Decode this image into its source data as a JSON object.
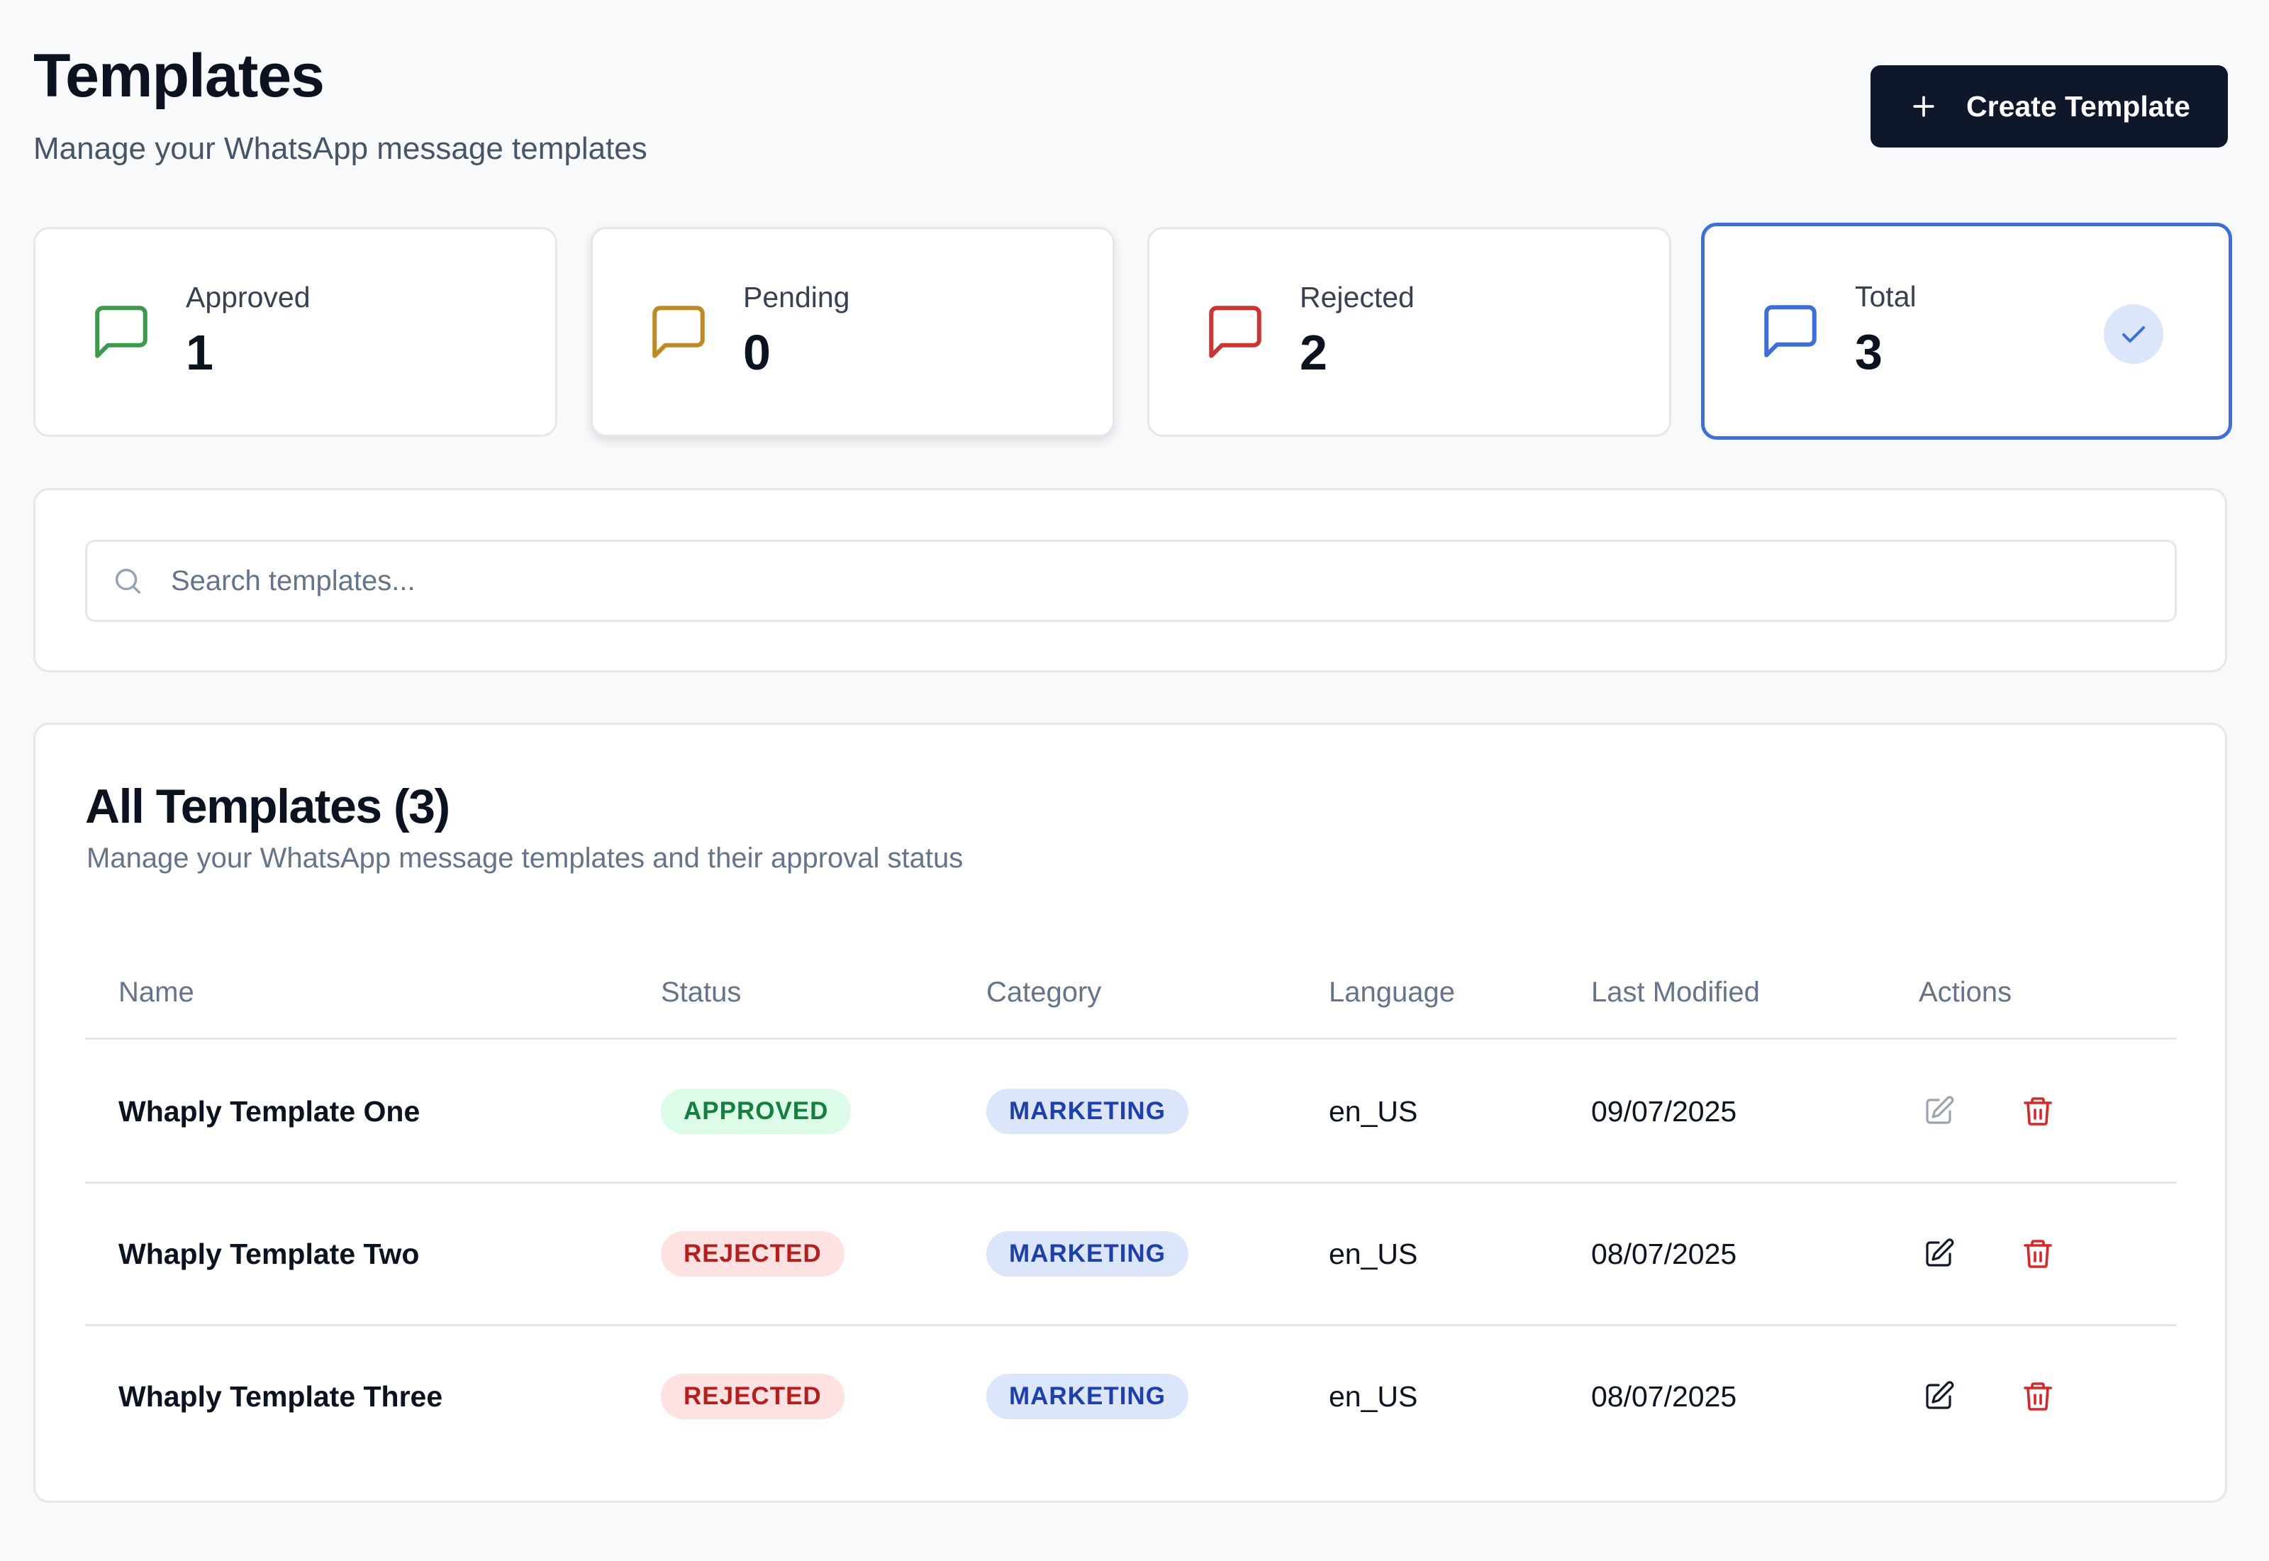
{
  "header": {
    "title": "Templates",
    "subtitle": "Manage your WhatsApp message templates",
    "create_button_label": "Create Template"
  },
  "stats": [
    {
      "label": "Approved",
      "value": "1",
      "color": "#3b9a4c"
    },
    {
      "label": "Pending",
      "value": "0",
      "color": "#c08a23"
    },
    {
      "label": "Rejected",
      "value": "2",
      "color": "#cf3434"
    },
    {
      "label": "Total",
      "value": "3",
      "color": "#3b6fdc",
      "selected": true
    }
  ],
  "search": {
    "placeholder": "Search templates...",
    "value": ""
  },
  "table": {
    "title": "All Templates (3)",
    "subtitle": "Manage your WhatsApp message templates and their approval status",
    "columns": [
      "Name",
      "Status",
      "Category",
      "Language",
      "Last Modified",
      "Actions"
    ],
    "rows": [
      {
        "name": "Whaply Template One",
        "status": "APPROVED",
        "category": "MARKETING",
        "language": "en_US",
        "modified": "09/07/2025",
        "edit_icon": "edit-icon",
        "delete_icon": "trash-icon"
      },
      {
        "name": "Whaply Template Two",
        "status": "REJECTED",
        "category": "MARKETING",
        "language": "en_US",
        "modified": "08/07/2025",
        "edit_icon": "edit-icon",
        "delete_icon": "trash-icon"
      },
      {
        "name": "Whaply Template Three",
        "status": "REJECTED",
        "category": "MARKETING",
        "language": "en_US",
        "modified": "08/07/2025",
        "edit_icon": "edit-icon",
        "delete_icon": "trash-icon"
      }
    ]
  },
  "colors": {
    "primary_button": "#0f172a",
    "accent": "#3b6fdc",
    "approved": "#15803d",
    "rejected": "#b91c1c",
    "category": "#1e40af"
  }
}
